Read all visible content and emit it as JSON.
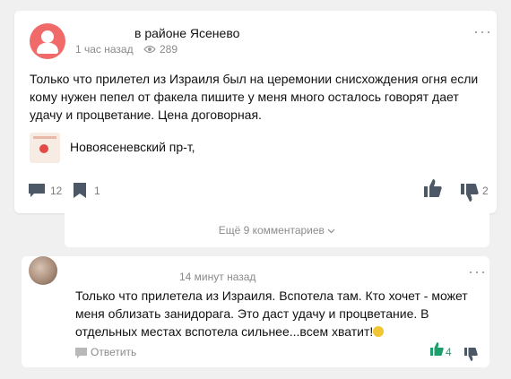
{
  "post": {
    "author_location": "в районе Ясенево",
    "time": "1 час назад",
    "views": "289",
    "text": "Только что прилетел из Израиля был на церемонии снисхождения огня если кому нужен пепел от факела пишите у меня много осталось говорят дает удачу и процветание. Цена договорная.",
    "place": "Новоясеневский пр-т,",
    "comments_count": "12",
    "bookmarks_count": "1",
    "dislikes_count": "2",
    "more": "···"
  },
  "show_more_comments": "Ещё 9 комментариев",
  "comment": {
    "time": "14 минут назад",
    "text": "Только что прилетела из Израиля. Вспотела там. Кто хочет - может меня облизать занидорага. Это даст удачу и процветание. В отдельных местах вспотела сильнее...всем хватит!",
    "reply_label": "Ответить",
    "likes_count": "4",
    "more": "···"
  },
  "colors": {
    "avatar": "#f06a6a",
    "like_active": "#1e9e6b",
    "icon_gray": "#4d5866"
  }
}
